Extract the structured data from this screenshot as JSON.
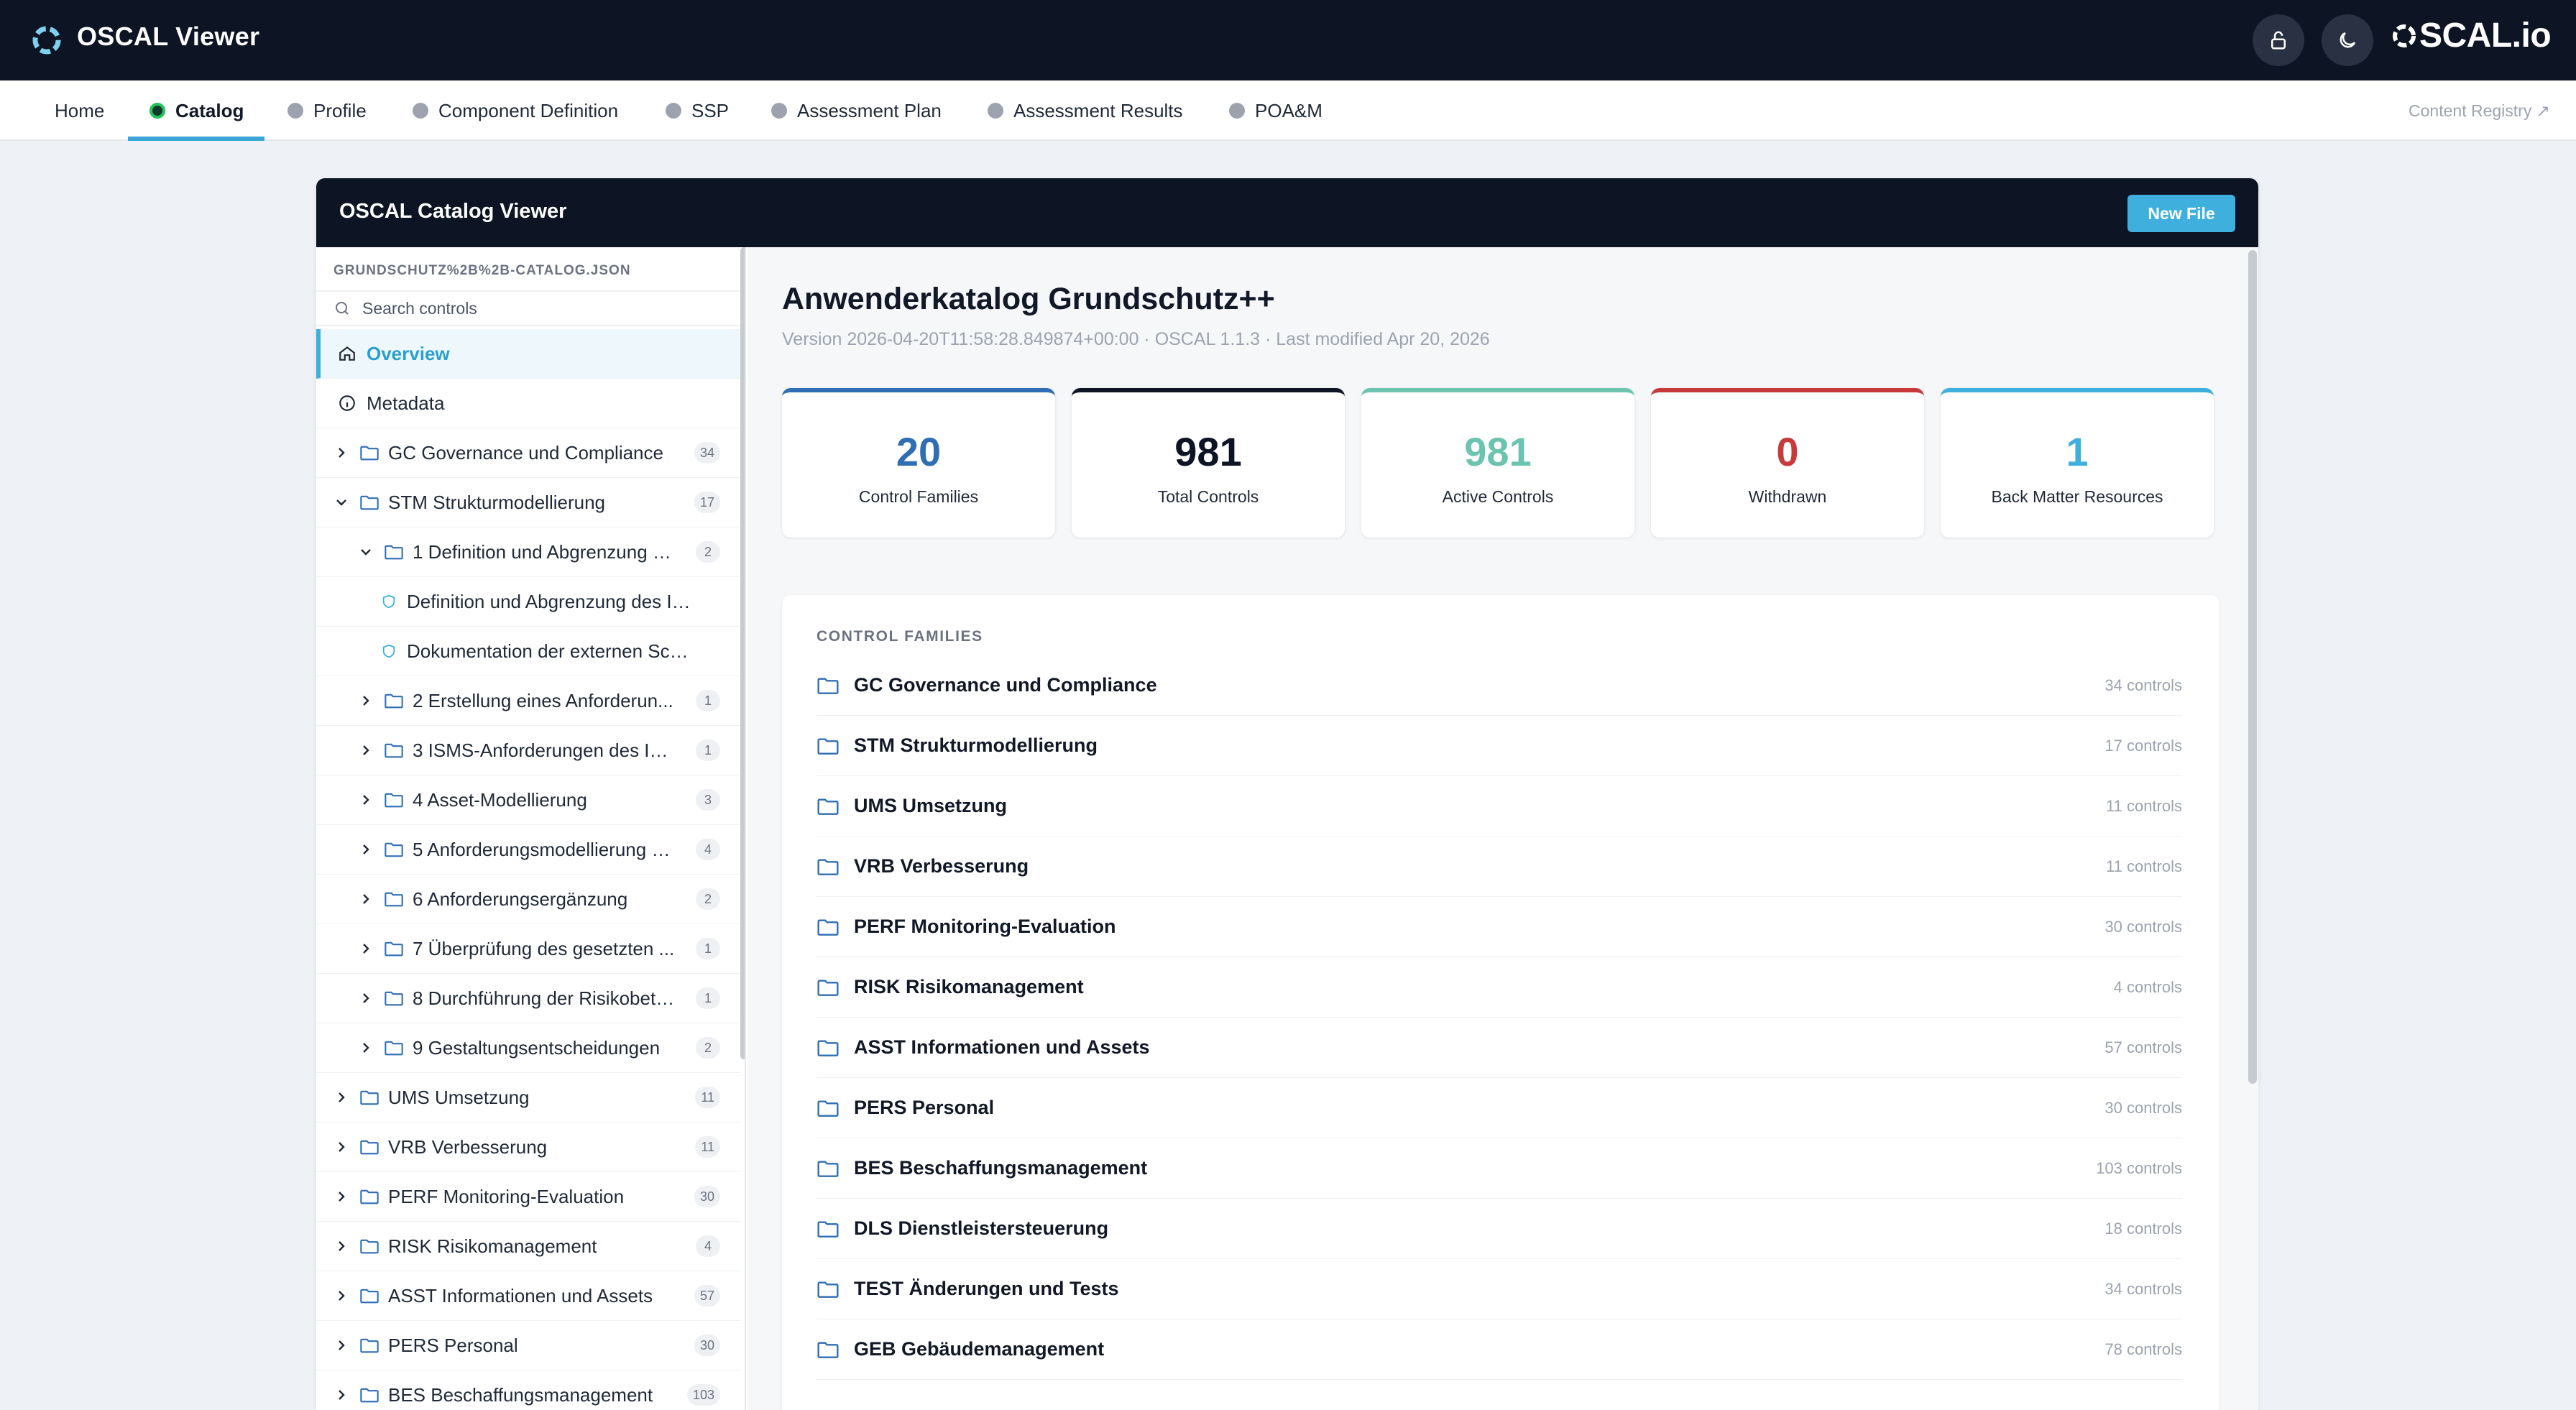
{
  "app": {
    "title": "OSCAL Viewer",
    "brand": "SCAL.io"
  },
  "nav": {
    "tabs": [
      {
        "label": "Home"
      },
      {
        "label": "Catalog",
        "active": true
      },
      {
        "label": "Profile"
      },
      {
        "label": "Component Definition"
      },
      {
        "label": "SSP"
      },
      {
        "label": "Assessment Plan"
      },
      {
        "label": "Assessment Results"
      },
      {
        "label": "POA&M"
      }
    ],
    "registry_label": "Content Registry ↗"
  },
  "viewer": {
    "title": "OSCAL Catalog Viewer",
    "new_file_label": "New File"
  },
  "sidebar": {
    "file_name": "GRUNDSCHUTZ%2B%2B-CATALOG.JSON",
    "search_placeholder": "Search controls",
    "overview_label": "Overview",
    "metadata_label": "Metadata",
    "tree": [
      {
        "label": "GC Governance und Compliance",
        "count": "34",
        "level": 0,
        "chev": "right"
      },
      {
        "label": "STM Strukturmodellierung",
        "count": "17",
        "level": 0,
        "chev": "down"
      },
      {
        "label": "1 Definition und Abgrenzung d...",
        "count": "2",
        "level": 1,
        "chev": "down"
      },
      {
        "label": "Definition und Abgrenzung des Infor...",
        "level": 2,
        "kind": "control"
      },
      {
        "label": "Dokumentation der externen Schnit...",
        "level": 2,
        "kind": "control"
      },
      {
        "label": "2 Erstellung eines Anforderun...",
        "count": "1",
        "level": 1,
        "chev": "right"
      },
      {
        "label": "3 ISMS-Anforderungen des Inf...",
        "count": "1",
        "level": 1,
        "chev": "right"
      },
      {
        "label": "4 Asset-Modellierung",
        "count": "3",
        "level": 1,
        "chev": "right"
      },
      {
        "label": "5 Anforderungsmodellierung a...",
        "count": "4",
        "level": 1,
        "chev": "right"
      },
      {
        "label": "6 Anforderungsergänzung",
        "count": "2",
        "level": 1,
        "chev": "right"
      },
      {
        "label": "7 Überprüfung des gesetzten ...",
        "count": "1",
        "level": 1,
        "chev": "right"
      },
      {
        "label": "8 Durchführung der Risikobetr...",
        "count": "1",
        "level": 1,
        "chev": "right"
      },
      {
        "label": "9 Gestaltungsentscheidungen",
        "count": "2",
        "level": 1,
        "chev": "right"
      },
      {
        "label": "UMS Umsetzung",
        "count": "11",
        "level": 0,
        "chev": "right"
      },
      {
        "label": "VRB Verbesserung",
        "count": "11",
        "level": 0,
        "chev": "right"
      },
      {
        "label": "PERF Monitoring-Evaluation",
        "count": "30",
        "level": 0,
        "chev": "right"
      },
      {
        "label": "RISK Risikomanagement",
        "count": "4",
        "level": 0,
        "chev": "right"
      },
      {
        "label": "ASST Informationen und Assets",
        "count": "57",
        "level": 0,
        "chev": "right"
      },
      {
        "label": "PERS Personal",
        "count": "30",
        "level": 0,
        "chev": "right"
      },
      {
        "label": "BES Beschaffungsmanagement",
        "count": "103",
        "level": 0,
        "chev": "right"
      }
    ]
  },
  "catalog": {
    "title": "Anwenderkatalog Grundschutz++",
    "subtitle": "Version 2026-04-20T11:58:28.849874+00:00 · OSCAL 1.1.3 · Last modified Apr 20, 2026",
    "stats": [
      {
        "value": "20",
        "label": "Control Families",
        "color": "#2f6eb5",
        "border": "#2f6eb5"
      },
      {
        "value": "981",
        "label": "Total Controls",
        "color": "#0d1424",
        "border": "#0d1424"
      },
      {
        "value": "981",
        "label": "Active Controls",
        "color": "#6cc4b0",
        "border": "#6cc4b0"
      },
      {
        "value": "0",
        "label": "Withdrawn",
        "color": "#c83a3a",
        "border": "#c83a3a"
      },
      {
        "value": "1",
        "label": "Back Matter Resources",
        "color": "#3fb0de",
        "border": "#3fb0de"
      }
    ],
    "families_heading": "CONTROL FAMILIES",
    "families": [
      {
        "name": "GC Governance und Compliance",
        "count": "34 controls"
      },
      {
        "name": "STM Strukturmodellierung",
        "count": "17 controls"
      },
      {
        "name": "UMS Umsetzung",
        "count": "11 controls"
      },
      {
        "name": "VRB Verbesserung",
        "count": "11 controls"
      },
      {
        "name": "PERF Monitoring-Evaluation",
        "count": "30 controls"
      },
      {
        "name": "RISK Risikomanagement",
        "count": "4 controls"
      },
      {
        "name": "ASST Informationen und Assets",
        "count": "57 controls"
      },
      {
        "name": "PERS Personal",
        "count": "30 controls"
      },
      {
        "name": "BES Beschaffungsmanagement",
        "count": "103 controls"
      },
      {
        "name": "DLS Dienstleistersteuerung",
        "count": "18 controls"
      },
      {
        "name": "TEST Änderungen und Tests",
        "count": "34 controls"
      },
      {
        "name": "GEB Gebäudemanagement",
        "count": "78 controls"
      }
    ]
  },
  "icons": {
    "logo": "oscal-ring-icon",
    "lock": "lock-icon",
    "theme": "moon-icon",
    "search": "search-icon",
    "home": "home-icon",
    "info": "info-icon",
    "folder": "folder-icon",
    "shield": "shield-icon"
  }
}
